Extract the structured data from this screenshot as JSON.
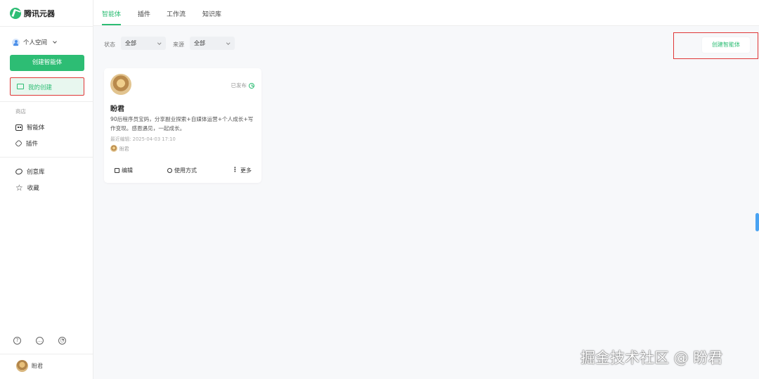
{
  "sidebar": {
    "logo_text": "腾讯元器",
    "workspace_label": "个人空间",
    "create_button": "创建智能体",
    "my_creation": "我的创建",
    "section_label": "商店",
    "items": [
      {
        "label": "智能体",
        "icon": "robot-icon"
      },
      {
        "label": "插件",
        "icon": "plugin-icon"
      },
      {
        "label": "创意库",
        "icon": "idea-icon"
      },
      {
        "label": "收藏",
        "icon": "star-icon"
      }
    ],
    "user_name": "盼君"
  },
  "topbar": {
    "tabs": [
      "智能体",
      "插件",
      "工作流",
      "知识库"
    ],
    "active_tab": "智能体"
  },
  "filters": {
    "status_label": "状态",
    "status_value": "全部",
    "source_label": "来源",
    "source_value": "全部"
  },
  "create_agent_button": "创建智能体",
  "card": {
    "status": "已发布",
    "title": "盼君",
    "description": "90后程序员宝妈，分享副业探索+自媒体运营+个人成长+写作变现。感恩遇见，一起成长。",
    "last_edited": "最近编辑: 2025-04-03 17:10",
    "author": "盼君",
    "actions": {
      "edit": "编辑",
      "usage": "使用方式",
      "more": "更多"
    }
  },
  "watermark": "掘金技术社区 @ 盼君",
  "colors": {
    "accent": "#2dbd74",
    "highlight_border": "#e03636",
    "scroll_handle": "#4aa3f2"
  }
}
